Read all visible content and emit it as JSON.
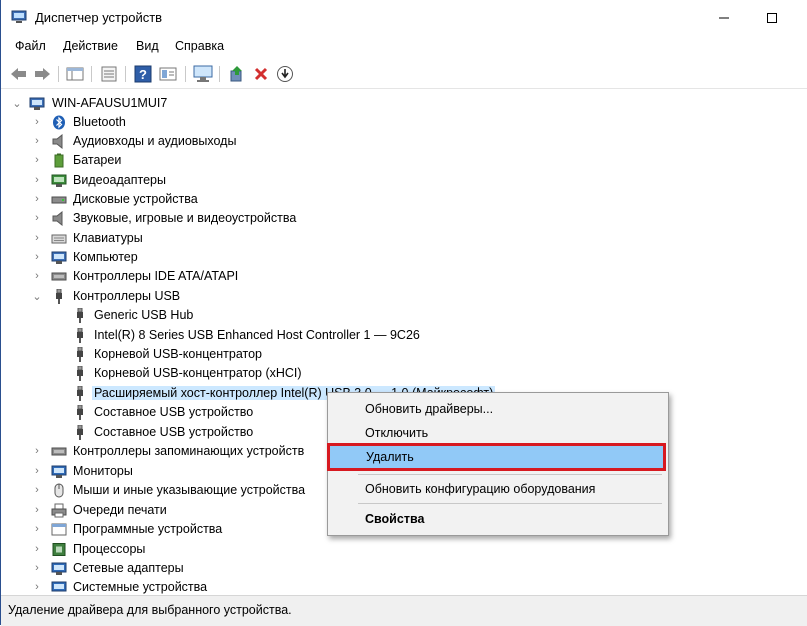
{
  "window": {
    "title": "Диспетчер устройств",
    "minimize_glyph": "—",
    "maximize_glyph": "☐"
  },
  "menu": [
    "Файл",
    "Действие",
    "Вид",
    "Справка"
  ],
  "toolbar_icons": [
    "back-icon",
    "forward-icon",
    "properties-view-icon",
    "list-icon",
    "help-icon",
    "details-icon",
    "monitor-icon",
    "update-driver-icon",
    "remove-icon",
    "scan-download-icon"
  ],
  "tree": {
    "root": "WIN-AFAUSU1MUI7",
    "categories": [
      "Bluetooth",
      "Аудиовходы и аудиовыходы",
      "Батареи",
      "Видеоадаптеры",
      "Дисковые устройства",
      "Звуковые, игровые и видеоустройства",
      "Клавиатуры",
      "Компьютер",
      "Контроллеры IDE ATA/ATAPI",
      "Контроллеры USB"
    ],
    "usb_children": [
      "Generic USB Hub",
      "Intel(R) 8 Series USB Enhanced Host Controller 1 — 9C26",
      "Корневой USB-концентратор",
      "Корневой USB-концентратор (xHCI)",
      "Расширяемый хост-контроллер Intel(R) USB 3.0 — 1.0 (Майкрософт)",
      "Составное USB устройство",
      "Составное USB устройство"
    ],
    "categories_after": [
      "Контроллеры запоминающих устройств",
      "Мониторы",
      "Мыши и иные указывающие устройства",
      "Очереди печати",
      "Программные устройства",
      "Процессоры",
      "Сетевые адаптеры",
      "Системные устройства"
    ]
  },
  "context_menu": {
    "update": "Обновить драйверы...",
    "disable": "Отключить",
    "uninstall": "Удалить",
    "scan": "Обновить конфигурацию оборудования",
    "properties": "Свойства"
  },
  "status": "Удаление драйвера для выбранного устройства.",
  "colors": {
    "highlight": "#91c9f7",
    "selection": "#cce8ff",
    "outline_red": "#d71920",
    "remove_red": "#d32f2f"
  }
}
